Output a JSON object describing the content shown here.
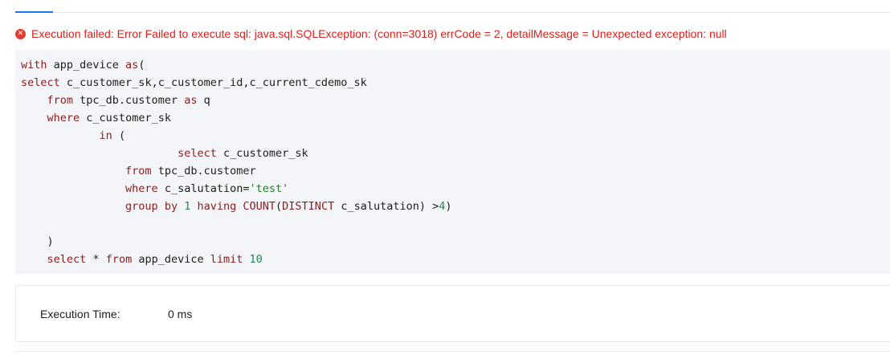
{
  "error": {
    "message": "Execution failed: Error Failed to execute sql: java.sql.SQLException: (conn=3018) errCode = 2, detailMessage = Unexpected exception: null",
    "icon": "error-circle-icon",
    "icon_glyph": "✕",
    "color": "#e0201c"
  },
  "code": {
    "l1": {
      "a": "with ",
      "b": "app_device ",
      "c": "as",
      "d": "("
    },
    "l2": {
      "a": "select ",
      "b": "c_customer_sk,c_customer_id,c_current_cdemo_sk"
    },
    "l3": {
      "a": "    ",
      "b": "from ",
      "c": "tpc_db.customer ",
      "d": "as ",
      "e": "q"
    },
    "l4": {
      "a": "    ",
      "b": "where ",
      "c": "c_customer_sk"
    },
    "l5": {
      "a": "            ",
      "b": "in ",
      "c": "("
    },
    "l6": {
      "a": "                        ",
      "b": "select ",
      "c": "c_customer_sk"
    },
    "l7": {
      "a": "                ",
      "b": "from ",
      "c": "tpc_db.customer"
    },
    "l8": {
      "a": "                ",
      "b": "where ",
      "c": "c_salutation=",
      "d": "'test'"
    },
    "l9": {
      "a": "                ",
      "b": "group by ",
      "c": "1",
      "d": " ",
      "e": "having ",
      "f": "COUNT",
      "g": "(",
      "h": "DISTINCT ",
      "i": "c_salutation) >",
      "j": "4",
      "k": ")"
    },
    "l10": {
      "a": ""
    },
    "l11": {
      "a": "    )"
    },
    "l12": {
      "a": "    ",
      "b": "select ",
      "c": "* ",
      "d": "from ",
      "e": "app_device ",
      "f": "limit ",
      "g": "10"
    }
  },
  "execution": {
    "label": "Execution Time:",
    "value": "0 ms"
  },
  "colors": {
    "accent": "#1677ff",
    "code_background": "#f4f5f9",
    "keyword": "#8a1d1d",
    "string": "#267a2e",
    "number": "#1f8a4c"
  }
}
